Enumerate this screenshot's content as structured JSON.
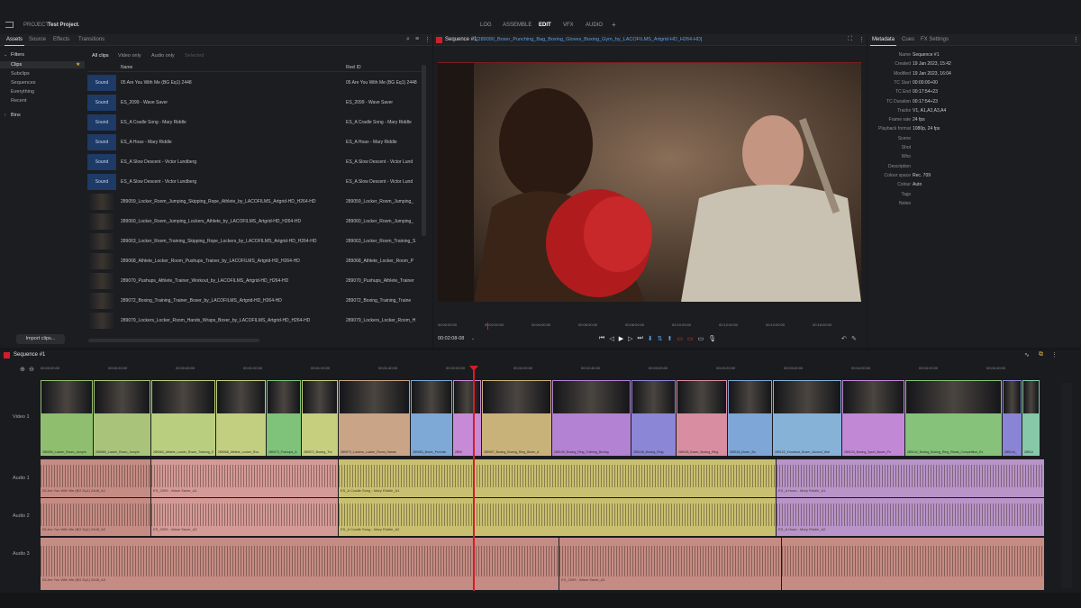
{
  "header": {
    "project_label": "PROJECT",
    "project_name": "Test Project",
    "modes": [
      "LOG",
      "ASSEMBLE",
      "EDIT",
      "VFX",
      "AUDIO"
    ],
    "active_mode": "EDIT",
    "add_label": "+"
  },
  "left_panel": {
    "tabs": [
      "Assets",
      "Source",
      "Effects",
      "Transitions"
    ],
    "filters_title": "Filters",
    "filters": [
      "Clips",
      "Subclips",
      "Sequences",
      "Everything",
      "Recent"
    ],
    "bins_label": "Bins",
    "import_button": "Import clips..."
  },
  "clips_list": {
    "tabs": [
      "All clips",
      "Video only",
      "Audio only",
      "Selected"
    ],
    "columns": [
      "Name",
      "Reel ID"
    ],
    "rows": [
      {
        "type": "sound",
        "name": "05 Are You With Me (BG Eq1) 2448",
        "reel": "05 Are You With Me (BG Eq1) 2448"
      },
      {
        "type": "sound",
        "name": "ES_2099 - Wave Saver",
        "reel": "ES_2099 - Wave Saver"
      },
      {
        "type": "sound",
        "name": "ES_A Cradle Song - Mary Riddle",
        "reel": "ES_A Cradle Song - Mary Riddle"
      },
      {
        "type": "sound",
        "name": "ES_A Hoax - Mary Riddle",
        "reel": "ES_A Hoax - Mary Riddle"
      },
      {
        "type": "sound",
        "name": "ES_A Slow Descent - Victor Lundberg",
        "reel": "ES_A Slow Descent - Victor Lund"
      },
      {
        "type": "sound",
        "name": "ES_A Slow Descent - Victor Lundberg",
        "reel": "ES_A Slow Descent - Victor Lund"
      },
      {
        "type": "video",
        "name": "289059_Locker_Room_Jumping_Skipping_Rope_Athlete_by_LACOFILMS_Artgrid-HD_H264-HD",
        "reel": "289059_Locker_Room_Jumping_"
      },
      {
        "type": "video",
        "name": "289060_Locker_Room_Jumping_Lockers_Athlete_by_LACOFILMS_Artgrid-HD_H264-HD",
        "reel": "289060_Locker_Room_Jumping_"
      },
      {
        "type": "video",
        "name": "289063_Locker_Room_Training_Skipping_Rope_Lockers_by_LACOFILMS_Artgrid-HD_H264-HD",
        "reel": "289063_Locker_Room_Training_S"
      },
      {
        "type": "video",
        "name": "289068_Athlete_Locker_Room_Pushups_Trainer_by_LACOFILMS_Artgrid-HD_H264-HD",
        "reel": "289068_Athlete_Locker_Room_P"
      },
      {
        "type": "video",
        "name": "289070_Pushups_Athlete_Trainer_Workout_by_LACOFILMS_Artgrid-HD_H264-HD",
        "reel": "289070_Pushups_Athlete_Trainer"
      },
      {
        "type": "video",
        "name": "289072_Boxing_Training_Trainer_Boxer_by_LACOFILMS_Artgrid-HD_H264-HD",
        "reel": "289072_Boxing_Training_Traine"
      },
      {
        "type": "video",
        "name": "289079_Lockers_Locker_Room_Hands_Wraps_Boxer_by_LACOFILMS_Artgrid-HD_H264-HD",
        "reel": "289079_Lockers_Locker_Room_H"
      }
    ]
  },
  "viewer": {
    "title": "Sequence #1",
    "clip_name": "[289090_Boxer_Punching_Bag_Boxing_Gloves_Boxing_Gym_by_LACOFILMS_Artgrid-HD_H264-HD]",
    "timecode": "00:02:08-08",
    "ruler": [
      "00:00:00:00",
      "00:02:00:00",
      "00:04:00:00",
      "00:06:00:00",
      "00:08:00:00",
      "00:10:00:00",
      "00:12:00:00",
      "00:14:00:00",
      "00:16:00:00"
    ]
  },
  "metadata": {
    "tabs": [
      "Metadata",
      "Cues",
      "FX Settings"
    ],
    "fields": [
      {
        "key": "Name",
        "value": "Sequence #1"
      },
      {
        "key": "Created",
        "value": "19 Jan 2023, 15:42"
      },
      {
        "key": "Modified",
        "value": "19 Jan 2023, 16:04"
      },
      {
        "key": "TC Start",
        "value": "00:00:00+00"
      },
      {
        "key": "TC End",
        "value": "00:17:54+23"
      },
      {
        "key": "TC Duration",
        "value": "00:17:54+23"
      },
      {
        "key": "Tracks",
        "value": "V1, A1,A2,A3,A4"
      },
      {
        "key": "Frame rate",
        "value": "24 fps"
      },
      {
        "key": "Playback format",
        "value": "1080p, 24 fps"
      },
      {
        "key": "Scene",
        "value": ""
      },
      {
        "key": "Shot",
        "value": ""
      },
      {
        "key": "Who",
        "value": ""
      },
      {
        "key": "Description",
        "value": ""
      },
      {
        "key": "Colour space",
        "value": "Rec. 709"
      },
      {
        "key": "Colour",
        "value": "Auto"
      },
      {
        "key": "Tags",
        "value": ""
      },
      {
        "key": "Notes",
        "value": ""
      }
    ]
  },
  "timeline": {
    "title": "Sequence #1",
    "ruler": [
      "00:00:00:00",
      "00:00:20:00",
      "00:00:40:00",
      "00:01:00:00",
      "00:01:20:00",
      "00:01:40:00",
      "00:02:00:00",
      "00:02:20:00",
      "00:02:40:00",
      "00:03:00:00",
      "00:03:20:00",
      "00:03:40:00",
      "00:04:00:00",
      "00:04:20:00",
      "00:04:40:00"
    ],
    "tracks": [
      "Video 1",
      "Audio 1",
      "Audio 2",
      "Audio 3"
    ],
    "video_clips": [
      {
        "name": "289059_Locker_Room_Jumpin",
        "color": "#8fbf6e"
      },
      {
        "name": "289060_Locker_Room_Jumpin",
        "color": "#a9c47a"
      },
      {
        "name": "289063_Athlete_Locker_Room_Training_Sk",
        "color": "#b9cf7f"
      },
      {
        "name": "289068_Athlete_Locker_Roo",
        "color": "#c3cf80"
      },
      {
        "name": "289070_Pushups_A",
        "color": "#7fc27a"
      },
      {
        "name": "289072_Boxing_Tra",
        "color": "#c6cf7e"
      },
      {
        "name": "289079_Lockers_Locker_Room_Hands",
        "color": "#c9a486"
      },
      {
        "name": "289083_Boxer_Punchin",
        "color": "#7ea8d6"
      },
      {
        "name": "2890",
        "color": "#c78ad6"
      },
      {
        "name": "289097_Boxing_Boxing_Ring_Boxer_A",
        "color": "#c9b27a"
      },
      {
        "name": "289105_Boxing_Ring_Training_Boxing",
        "color": "#b482d2"
      },
      {
        "name": "289108_Boxing_Ring",
        "color": "#8c86d6"
      },
      {
        "name": "289118_Boxer_Boxing_Ring",
        "color": "#d88ea0"
      },
      {
        "name": "289118_Boxer_Bo",
        "color": "#7ea6d6"
      },
      {
        "name": "289122_Knockout_Boxer_Alcohol_Wat",
        "color": "#86b2d8"
      },
      {
        "name": "289124_Boxing_Sport_Boxer_Pu",
        "color": "#c188d6"
      },
      {
        "name": "289142_Boxing_Boxing_Ring_Rivals_Competition_Ex",
        "color": "#86c27a"
      },
      {
        "name": "289144_",
        "color": "#8a84d4"
      },
      {
        "name": "28914",
        "color": "#86c8a8"
      }
    ],
    "audio1_clips": [
      {
        "name": "05 Are You With Me (BG Eq1) 2448_A1",
        "color": "#c58c84"
      },
      {
        "name": "ES_2099 - Wave Saver_A1",
        "color": "#d49a96"
      },
      {
        "name": "ES_A Cradle Song - Mary Riddle_A1",
        "color": "#c8c070"
      },
      {
        "name": "ES_A Hoax - Mary Riddle_A1",
        "color": "#b894c8"
      }
    ],
    "audio2_clips": [
      {
        "name": "05 Are You With Me (BG Eq1) 2448_A2",
        "color": "#c58c84"
      },
      {
        "name": "ES_2099 - Wave Saver_A2",
        "color": "#d49a96"
      },
      {
        "name": "ES_A Cradle Song - Mary Riddle_A2",
        "color": "#c8c070"
      },
      {
        "name": "ES_A Hoax - Mary Riddle_A2",
        "color": "#b894c8"
      }
    ],
    "audio3_clips": [
      {
        "name": "05 Are You With Me (BG Eq1) 2448_A3",
        "color": "#c58c84"
      },
      {
        "name": "ES_2099 - Wave Saver_A1",
        "color": "#c58c84"
      },
      {
        "name": "",
        "color": "#c58c84"
      }
    ]
  },
  "colors": {
    "accent_red": "#d01f2a",
    "sound_thumb": "#1e3a66"
  }
}
